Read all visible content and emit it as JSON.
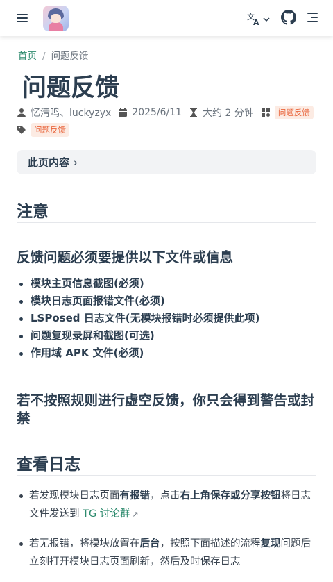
{
  "navbar": {
    "menu_icon": "menu-icon",
    "logo_icon": "site-logo",
    "language_icon": "translate-icon",
    "language_chevron_icon": "chevron-down-icon",
    "github_icon": "github-icon",
    "outline_icon": "outline-icon"
  },
  "breadcrumb": {
    "home": "首页",
    "separator": "/",
    "current": "问题反馈"
  },
  "page": {
    "title": "问题反馈"
  },
  "meta": {
    "author": "忆清鸣、luckyzyx",
    "date": "2025/6/11",
    "reading_time": "大约 2 分钟",
    "category": "问题反馈",
    "tag": "问题反馈"
  },
  "toc": {
    "label": "此页内容",
    "chevron": "›"
  },
  "content": {
    "notice_heading": "注意",
    "required_heading": "反馈问题必须要提供以下文件或信息",
    "required_items": [
      "模块主页信息截图(必须)",
      "模块日志页面报错文件(必须)",
      "LSPosed 日志文件(无模块报错时必须提供此项)",
      "问题复现录屏和截图(可选)",
      "作用域 APK 文件(必须)"
    ],
    "warning_heading": "若不按照规则进行虚空反馈，你只会得到警告或封禁",
    "log_heading": "查看日志",
    "log_items": [
      {
        "p1": "若发现模块日志页面",
        "b1": "有报错",
        "p2": "，点击",
        "b2": "右上角保存或分享按钮",
        "p3": "将日志文件发送到 ",
        "link": "TG 讨论群",
        "link_icon": "↗"
      },
      {
        "p1": "若无报错，将模块放置在",
        "b1": "后台",
        "p2": "，按照下面描述的流程",
        "b2": "复现",
        "p3": "问题后立刻打开模块日志页面刷新，然后及时保存日志"
      }
    ]
  },
  "colors": {
    "accent": "#2e8b6e",
    "tag_text": "#e9663d",
    "tag_bg": "#fcebe3",
    "text": "#2c3e50"
  }
}
